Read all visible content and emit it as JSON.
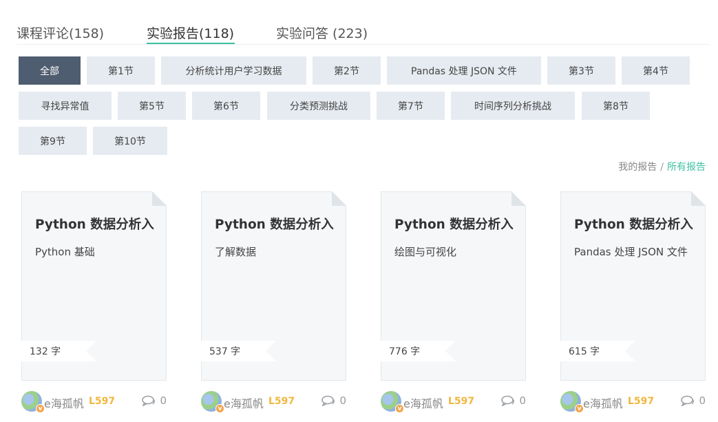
{
  "tabs": [
    {
      "label": "课程评论(158)"
    },
    {
      "label": "实验报告(118)"
    },
    {
      "label": "实验问答 (223)"
    }
  ],
  "filters": [
    {
      "label": "全部",
      "active": true
    },
    {
      "label": "第1节"
    },
    {
      "label": "分析统计用户学习数据"
    },
    {
      "label": "第2节"
    },
    {
      "label": "Pandas 处理 JSON 文件"
    },
    {
      "label": "第3节"
    },
    {
      "label": "第4节"
    },
    {
      "label": "寻找异常值"
    },
    {
      "label": "第5节"
    },
    {
      "label": "第6节"
    },
    {
      "label": "分类预测挑战"
    },
    {
      "label": "第7节"
    },
    {
      "label": "时间序列分析挑战"
    },
    {
      "label": "第8节"
    },
    {
      "label": "第9节"
    },
    {
      "label": "第10节"
    }
  ],
  "report_switch": {
    "mine": "我的报告",
    "separator": "/",
    "all": "所有报告"
  },
  "cards": [
    {
      "title": "Python 数据分析入",
      "subtitle": "Python 基础",
      "words": "132 字",
      "user": "e海孤帆",
      "level": "L597",
      "comments": "0"
    },
    {
      "title": "Python 数据分析入",
      "subtitle": "了解数据",
      "words": "537 字",
      "user": "e海孤帆",
      "level": "L597",
      "comments": "0"
    },
    {
      "title": "Python 数据分析入",
      "subtitle": "绘图与可视化",
      "words": "776 字",
      "user": "e海孤帆",
      "level": "L597",
      "comments": "0"
    },
    {
      "title": "Python 数据分析入",
      "subtitle": "Pandas 处理 JSON 文件",
      "words": "615 字",
      "user": "e海孤帆",
      "level": "L597",
      "comments": "0"
    }
  ],
  "icons": {
    "comment": "comment-icon",
    "avatar_badge": "v"
  },
  "colors": {
    "accent": "#3ec0a3",
    "active_chip": "#4f5d70",
    "chip": "#e6ebf1",
    "level": "#f0b73d"
  }
}
